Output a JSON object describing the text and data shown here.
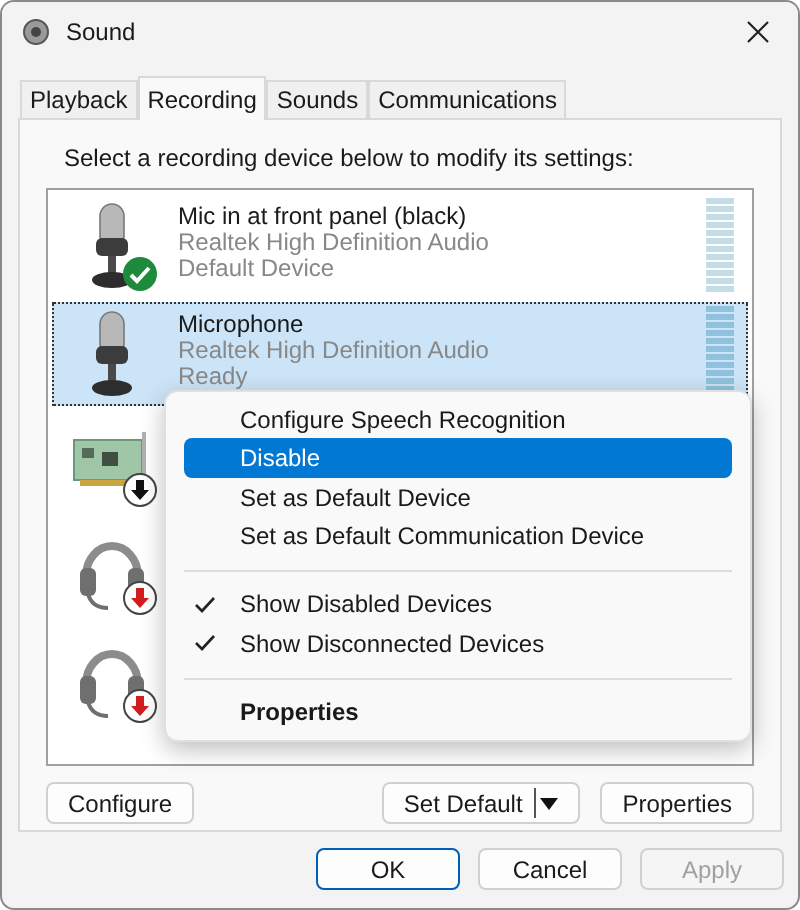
{
  "window": {
    "title": "Sound"
  },
  "tabs": [
    {
      "label": "Playback",
      "selected": false
    },
    {
      "label": "Recording",
      "selected": true
    },
    {
      "label": "Sounds",
      "selected": false
    },
    {
      "label": "Communications",
      "selected": false
    }
  ],
  "instruction": "Select a recording device below to modify its settings:",
  "devices": [
    {
      "kind": "microphone",
      "name": "Mic in at front panel (black)",
      "driver": "Realtek High Definition Audio",
      "status": "Default Device",
      "is_default": true,
      "disabled": false,
      "unplugged": false,
      "selected": false
    },
    {
      "kind": "microphone",
      "name": "Microphone",
      "driver": "Realtek High Definition Audio",
      "status": "Ready",
      "is_default": false,
      "disabled": false,
      "unplugged": false,
      "selected": true
    },
    {
      "kind": "card",
      "is_default": false,
      "disabled": true,
      "unplugged": false,
      "selected": false
    },
    {
      "kind": "headset",
      "is_default": false,
      "disabled": false,
      "unplugged": true,
      "selected": false
    },
    {
      "kind": "headset",
      "is_default": false,
      "disabled": false,
      "unplugged": true,
      "selected": false
    }
  ],
  "context_menu": {
    "items": [
      {
        "kind": "item",
        "label": "Configure Speech Recognition",
        "selected": false
      },
      {
        "kind": "item",
        "label": "Disable",
        "selected": true
      },
      {
        "kind": "item",
        "label": "Set as Default Device",
        "selected": false
      },
      {
        "kind": "item",
        "label": "Set as Default Communication Device",
        "selected": false
      },
      {
        "kind": "separator"
      },
      {
        "kind": "toggle",
        "label": "Show Disabled Devices",
        "checked": true
      },
      {
        "kind": "toggle",
        "label": "Show Disconnected Devices",
        "checked": true
      },
      {
        "kind": "separator"
      },
      {
        "kind": "default",
        "label": "Properties"
      }
    ]
  },
  "device_buttons": [
    {
      "label": "Configure",
      "split": false
    },
    {
      "label": "Set Default",
      "split": true
    },
    {
      "label": "Properties",
      "split": false
    }
  ],
  "dialog_buttons": [
    {
      "label": "OK",
      "default": true,
      "disabled": false
    },
    {
      "label": "Cancel",
      "default": false,
      "disabled": false
    },
    {
      "label": "Apply",
      "default": false,
      "disabled": true
    }
  ]
}
